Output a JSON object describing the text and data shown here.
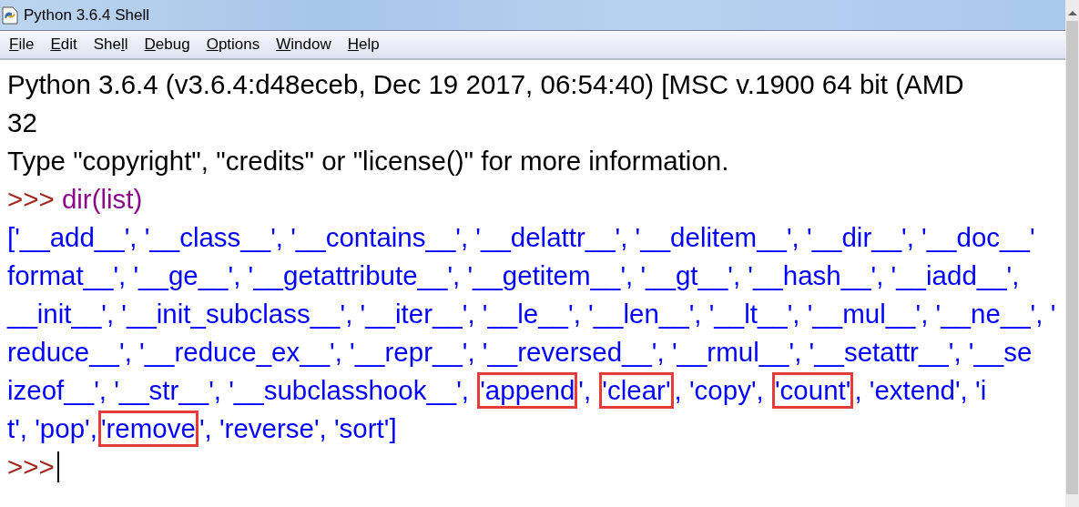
{
  "window": {
    "title": "Python 3.6.4 Shell"
  },
  "menu": [
    {
      "key": "F",
      "post": "ile"
    },
    {
      "key": "E",
      "post": "dit"
    },
    {
      "pre": "She",
      "key": "l",
      "post": "l"
    },
    {
      "key": "D",
      "post": "ebug"
    },
    {
      "key": "O",
      "post": "ptions"
    },
    {
      "key": "W",
      "post": "indow"
    },
    {
      "key": "H",
      "post": "elp"
    }
  ],
  "shell": [
    {
      "kind": "banner",
      "text": "Python 3.6.4 (v3.6.4:d48eceb, Dec 19 2017, 06:54:40) [MSC v.1900 64 bit (AMD"
    },
    {
      "kind": "banner",
      "text": "32"
    },
    {
      "kind": "banner",
      "text": "Type \"copyright\", \"credits\" or \"license()\" for more information."
    },
    {
      "kind": "input",
      "prompt": ">>> ",
      "code": "dir(list)",
      "cursor": false
    },
    {
      "kind": "output",
      "segments": [
        {
          "text": "['__add__', '__class__', '__contains__', '__delattr__', '__delitem__', '__dir__', '__doc__'",
          "boxed": false
        }
      ]
    },
    {
      "kind": "output",
      "segments": [
        {
          "text": "format__', '__ge__', '__getattribute__', '__getitem__', '__gt__', '__hash__', '__iadd__',",
          "boxed": false
        }
      ]
    },
    {
      "kind": "output",
      "segments": [
        {
          "text": "__init__', '__init_subclass__', '__iter__', '__le__', '__len__', '__lt__', '__mul__', '__ne__', '",
          "boxed": false
        }
      ]
    },
    {
      "kind": "output",
      "segments": [
        {
          "text": "reduce__', '__reduce_ex__', '__repr__', '__reversed__', '__rmul__', '__setattr__', '__se",
          "boxed": false
        }
      ]
    },
    {
      "kind": "output",
      "segments": [
        {
          "text": "izeof__', '__str__', '__subclasshook__', ",
          "boxed": false
        },
        {
          "text": "'append",
          "boxed": true
        },
        {
          "text": "', ",
          "boxed": false
        },
        {
          "text": "'clear'",
          "boxed": true
        },
        {
          "text": ", 'copy', ",
          "boxed": false
        },
        {
          "text": "'count'",
          "boxed": true
        },
        {
          "text": ", 'extend', 'i",
          "boxed": false
        }
      ]
    },
    {
      "kind": "output",
      "segments": [
        {
          "text": "t', 'pop',",
          "boxed": false
        },
        {
          "text": "'remove",
          "boxed": true
        },
        {
          "text": "', 'reverse', 'sort']",
          "boxed": false
        }
      ]
    },
    {
      "kind": "input",
      "prompt": ">>>",
      "cursor": true
    }
  ]
}
